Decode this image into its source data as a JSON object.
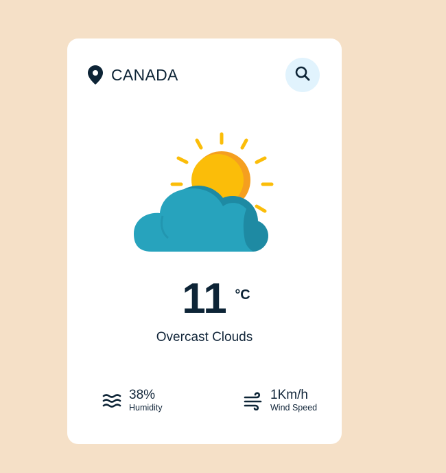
{
  "location": {
    "icon": "map-pin-icon",
    "city": "CANADA"
  },
  "search": {
    "icon": "search-icon"
  },
  "weather": {
    "icon": "partly-cloudy-sun-icon",
    "temperature": "11",
    "unit": "°C",
    "description": "Overcast Clouds"
  },
  "details": {
    "humidity": {
      "icon": "waves-icon",
      "value": "38%",
      "label": "Humidity"
    },
    "wind": {
      "icon": "wind-icon",
      "value": "1Km/h",
      "label": "Wind Speed"
    }
  },
  "colors": {
    "background": "#f5e0c7",
    "card": "#ffffff",
    "text": "#0d2436",
    "search_bg": "#e1f3fd",
    "sun": "#fbbd09",
    "sun_shade": "#f59f1f",
    "cloud": "#27a3bd",
    "cloud_shade": "#1e8aa3"
  }
}
